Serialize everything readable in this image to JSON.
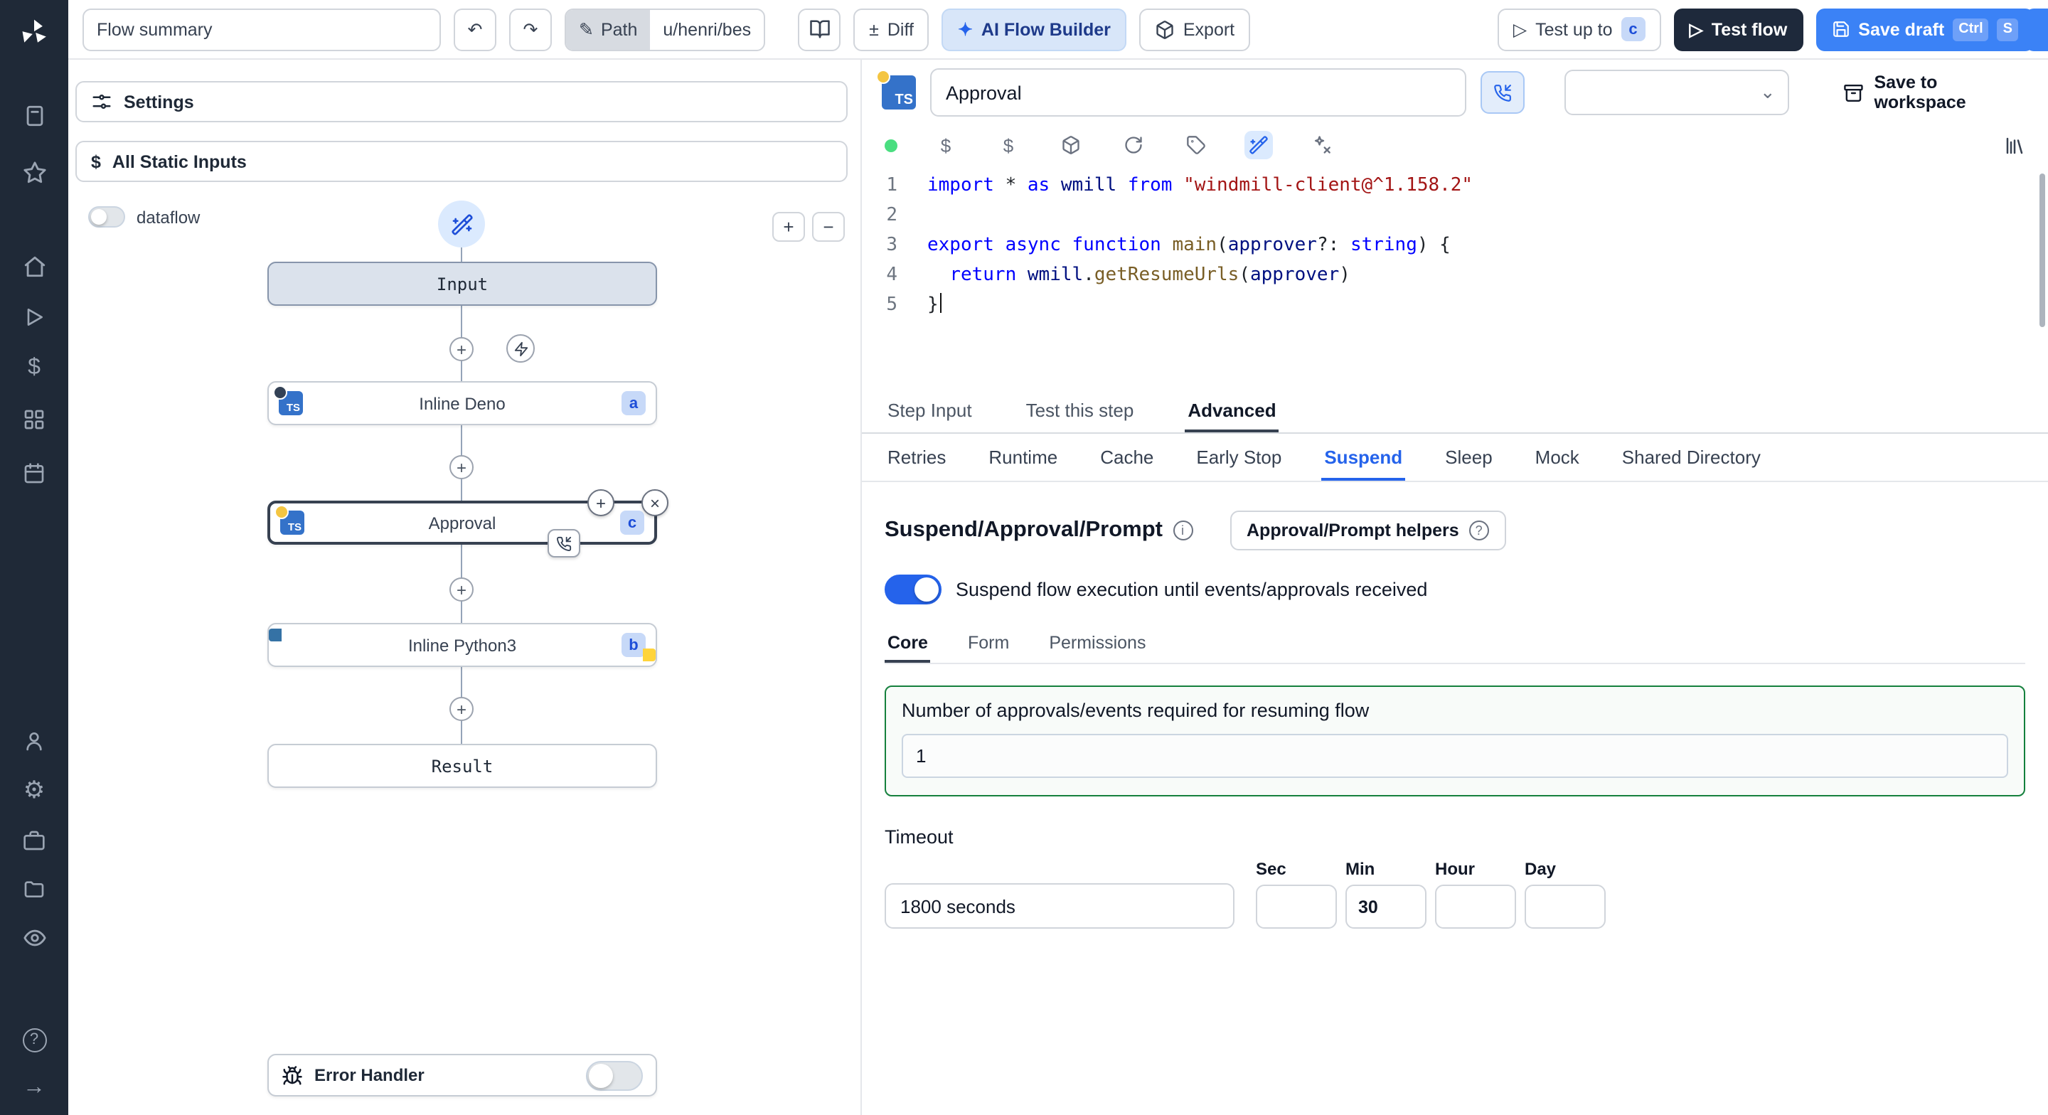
{
  "icons": {
    "undo": "↶",
    "redo": "↷",
    "pencil": "✎",
    "diff_plus": "±",
    "sparkle": "✦",
    "play": "▷",
    "chevron_down": "⌄",
    "dollar": "$",
    "plus": "+",
    "minus": "−",
    "close": "×",
    "rail": {
      "dollar": "$",
      "gear": "⚙",
      "arrow_right": "→",
      "help": "?"
    }
  },
  "topbar": {
    "flow_summary_value": "Flow summary",
    "path_label": "Path",
    "path_value": "u/henri/bes",
    "diff_label": "Diff",
    "ai_builder_label": "AI Flow Builder",
    "export_label": "Export",
    "test_up_to_label": "Test up to",
    "test_up_to_badge": "c",
    "test_flow_label": "Test flow",
    "save_draft_label": "Save draft",
    "save_draft_key1": "Ctrl",
    "save_draft_key2": "S"
  },
  "flow_panel": {
    "settings_label": "Settings",
    "static_inputs_label": "All Static Inputs",
    "dataflow_label": "dataflow",
    "ts_label": "TS",
    "input_node_label": "Input",
    "deno_node_label": "Inline Deno",
    "deno_badge": "a",
    "approval_node_label": "Approval",
    "approval_badge": "c",
    "python_node_label": "Inline Python3",
    "python_badge": "b",
    "result_node_label": "Result",
    "error_handler_label": "Error Handler"
  },
  "step_panel": {
    "name_value": "Approval",
    "save_to_workspace_label": "Save to workspace",
    "tabs": [
      "Step Input",
      "Test this step",
      "Advanced"
    ],
    "active_tab": "Advanced",
    "advanced_tabs": [
      "Retries",
      "Runtime",
      "Cache",
      "Early Stop",
      "Suspend",
      "Sleep",
      "Mock",
      "Shared Directory"
    ],
    "active_advanced_tab": "Suspend",
    "code": {
      "lines": [
        {
          "n": 1,
          "tokens": [
            {
              "t": "import",
              "c": "k"
            },
            {
              "t": " ",
              "c": "p"
            },
            {
              "t": "*",
              "c": "p"
            },
            {
              "t": " ",
              "c": "p"
            },
            {
              "t": "as",
              "c": "k"
            },
            {
              "t": " ",
              "c": "p"
            },
            {
              "t": "wmill",
              "c": "v"
            },
            {
              "t": " ",
              "c": "p"
            },
            {
              "t": "from",
              "c": "k"
            },
            {
              "t": " ",
              "c": "p"
            },
            {
              "t": "\"windmill-client@^1.158.2\"",
              "c": "s"
            }
          ]
        },
        {
          "n": 2,
          "tokens": []
        },
        {
          "n": 3,
          "tokens": [
            {
              "t": "export",
              "c": "k"
            },
            {
              "t": " ",
              "c": "p"
            },
            {
              "t": "async",
              "c": "k"
            },
            {
              "t": " ",
              "c": "p"
            },
            {
              "t": "function",
              "c": "k"
            },
            {
              "t": " ",
              "c": "p"
            },
            {
              "t": "main",
              "c": "f"
            },
            {
              "t": "(",
              "c": "p"
            },
            {
              "t": "approver",
              "c": "v"
            },
            {
              "t": "?: ",
              "c": "p"
            },
            {
              "t": "string",
              "c": "k"
            },
            {
              "t": ") {",
              "c": "p"
            }
          ]
        },
        {
          "n": 4,
          "tokens": [
            {
              "t": "  ",
              "c": "p"
            },
            {
              "t": "return",
              "c": "k"
            },
            {
              "t": " ",
              "c": "p"
            },
            {
              "t": "wmill",
              "c": "v"
            },
            {
              "t": ".",
              "c": "p"
            },
            {
              "t": "getResumeUrls",
              "c": "f"
            },
            {
              "t": "(",
              "c": "p"
            },
            {
              "t": "approver",
              "c": "v"
            },
            {
              "t": ")",
              "c": "p"
            }
          ]
        },
        {
          "n": 5,
          "tokens": [
            {
              "t": "}",
              "c": "p"
            }
          ]
        }
      ]
    },
    "suspend": {
      "title": "Suspend/Approval/Prompt",
      "helpers_button_label": "Approval/Prompt helpers",
      "toggle_label": "Suspend flow execution until events/approvals received",
      "tabs": [
        "Core",
        "Form",
        "Permissions"
      ],
      "active_tab": "Core",
      "approvals_label": "Number of approvals/events required for resuming flow",
      "approvals_value": "1",
      "timeout_label": "Timeout",
      "timeout_value": "1800 seconds",
      "units": [
        {
          "label": "Sec",
          "value": ""
        },
        {
          "label": "Min",
          "value": "30"
        },
        {
          "label": "Hour",
          "value": ""
        },
        {
          "label": "Day",
          "value": ""
        }
      ]
    }
  }
}
